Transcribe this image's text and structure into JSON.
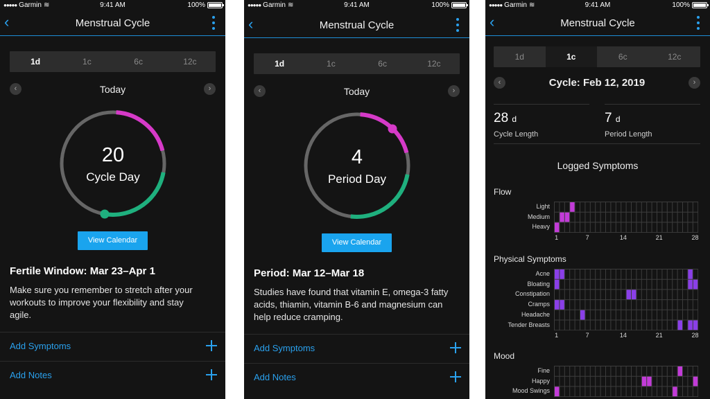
{
  "status": {
    "carrier": "Garmin",
    "time": "9:41 AM",
    "battery": "100%"
  },
  "colors": {
    "accent": "#1aa4ee",
    "fertile": "#d63ac8",
    "cycle_green": "#1fb07e",
    "ring_gray": "#666666",
    "flow": "#c23bd8",
    "symptom": "#8a3fe8"
  },
  "screens": [
    {
      "nav_title": "Menstrual Cycle",
      "tabs": [
        "1d",
        "1c",
        "6c",
        "12c"
      ],
      "active_tab": "1d",
      "date_label": "Today",
      "ring_number": "20",
      "ring_label": "Cycle Day",
      "progress_day": 20,
      "cycle_length": 28,
      "view_calendar": "View Calendar",
      "info_title": "Fertile Window: Mar 23–Apr 1",
      "info_body": "Make sure you remember to stretch after your workouts to improve your flexibility and stay agile.",
      "add_symptoms": "Add Symptoms",
      "add_notes": "Add Notes"
    },
    {
      "nav_title": "Menstrual Cycle",
      "tabs": [
        "1d",
        "1c",
        "6c",
        "12c"
      ],
      "active_tab": "1d",
      "date_label": "Today",
      "ring_number": "4",
      "ring_label": "Period Day",
      "progress_day": 4,
      "cycle_length": 28,
      "view_calendar": "View Calendar",
      "info_title": "Period: Mar 12–Mar 18",
      "info_body": "Studies have found that vitamin E, omega-3 fatty acids, thiamin, vitamin B-6 and magnesium can help reduce cramping.",
      "add_symptoms": "Add Symptoms",
      "add_notes": "Add Notes"
    },
    {
      "nav_title": "Menstrual Cycle",
      "tabs": [
        "1d",
        "1c",
        "6c",
        "12c"
      ],
      "active_tab": "1c",
      "date_label": "Cycle: Feb 12, 2019",
      "cycle_length_value": "28",
      "cycle_length_unit": "d",
      "cycle_length_caption": "Cycle Length",
      "period_length_value": "7",
      "period_length_unit": "d",
      "period_length_caption": "Period Length",
      "logged_title": "Logged Symptoms",
      "axis_ticks": [
        "1",
        "7",
        "14",
        "21",
        "28"
      ],
      "sections": [
        {
          "title": "Flow",
          "color": "#c23bd8",
          "rows": [
            {
              "label": "Light",
              "days": [
                4
              ]
            },
            {
              "label": "Medium",
              "days": [
                2,
                3
              ]
            },
            {
              "label": "Heavy",
              "days": [
                1
              ]
            }
          ]
        },
        {
          "title": "Physical Symptoms",
          "color": "#8a3fe8",
          "rows": [
            {
              "label": "Acne",
              "days": [
                1,
                2,
                27
              ]
            },
            {
              "label": "Bloating",
              "days": [
                1,
                27,
                28
              ]
            },
            {
              "label": "Constipation",
              "days": [
                15,
                16
              ]
            },
            {
              "label": "Cramps",
              "days": [
                1,
                2
              ]
            },
            {
              "label": "Headache",
              "days": [
                6
              ]
            },
            {
              "label": "Tender Breasts",
              "days": [
                25,
                27,
                28
              ]
            }
          ]
        },
        {
          "title": "Mood",
          "color": "#c23bd8",
          "rows": [
            {
              "label": "Fine",
              "days": [
                25
              ]
            },
            {
              "label": "Happy",
              "days": [
                18,
                19,
                28
              ]
            },
            {
              "label": "Mood Swings",
              "days": [
                1,
                24
              ]
            }
          ]
        }
      ]
    }
  ]
}
